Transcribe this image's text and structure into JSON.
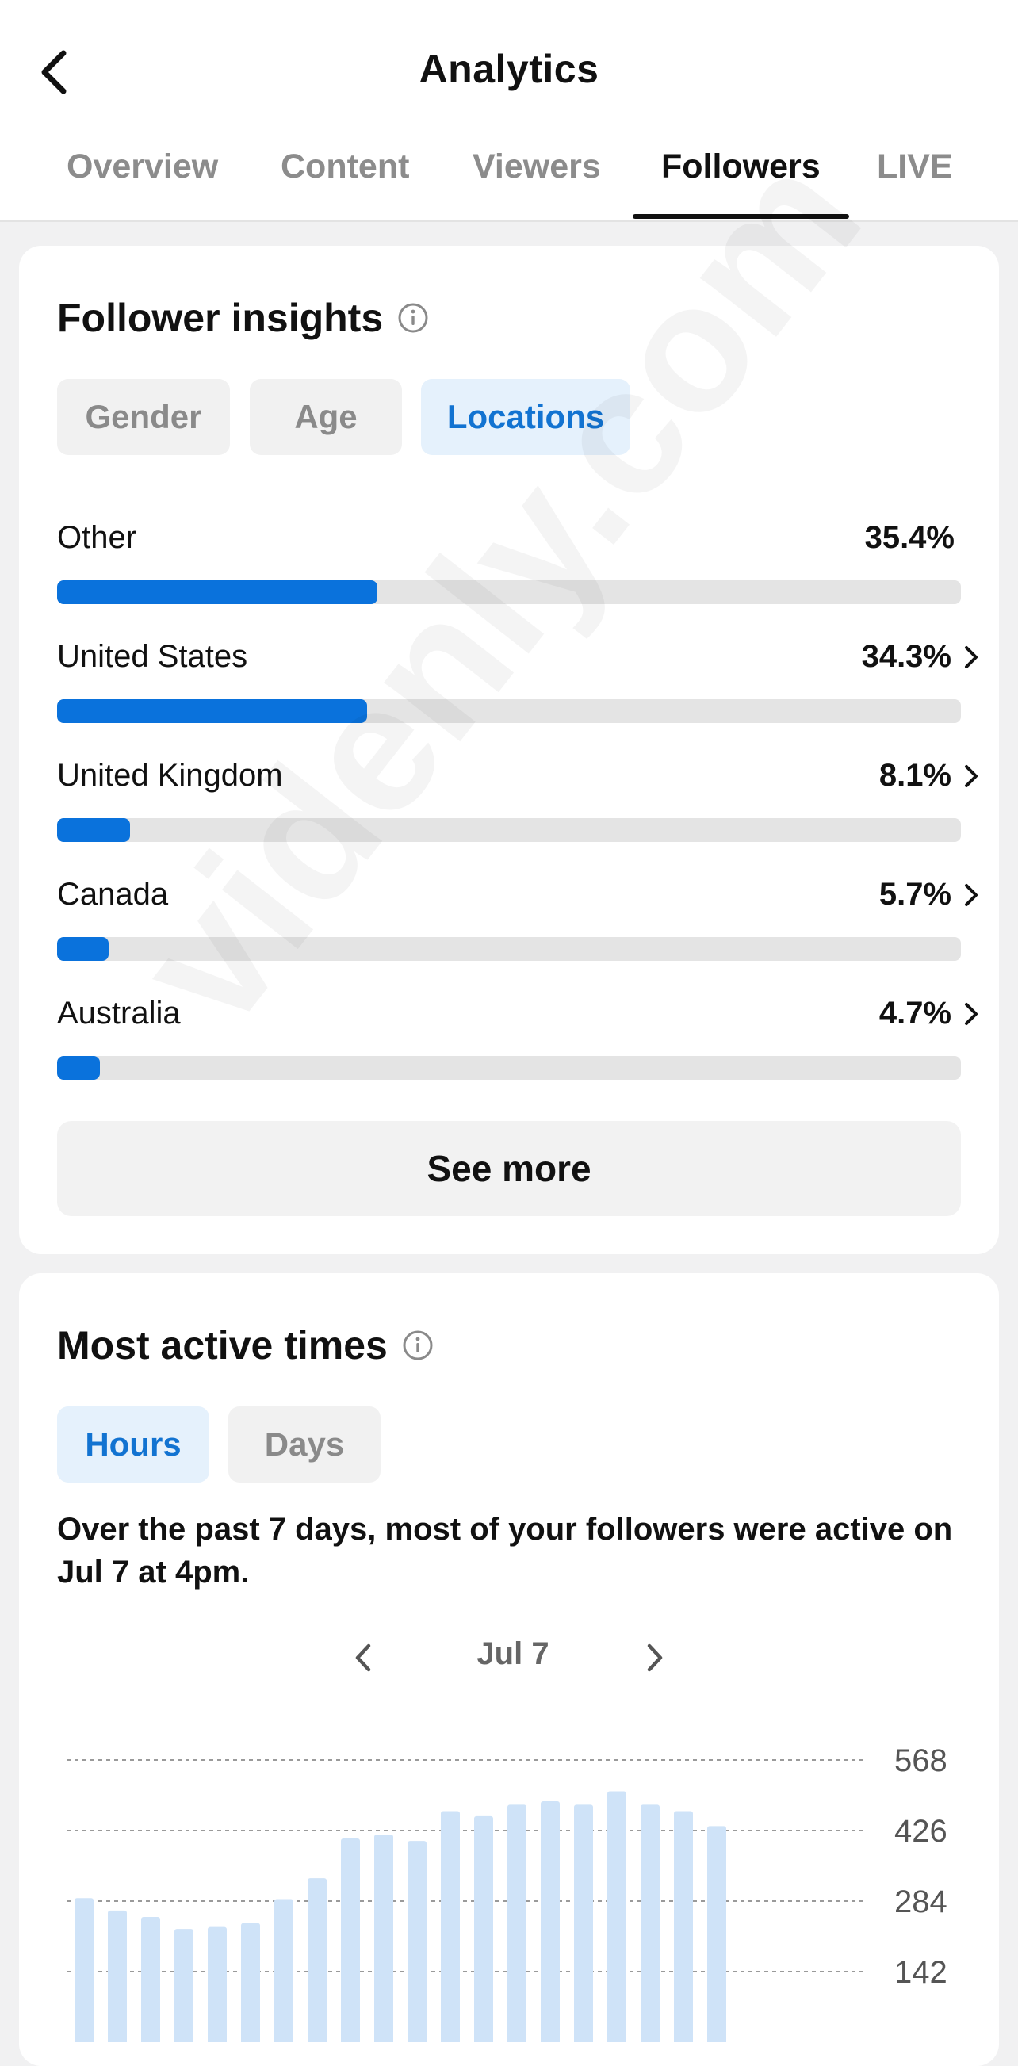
{
  "header": {
    "title": "Analytics",
    "tabs": [
      {
        "label": "Overview",
        "active": false
      },
      {
        "label": "Content",
        "active": false
      },
      {
        "label": "Viewers",
        "active": false
      },
      {
        "label": "Followers",
        "active": true
      },
      {
        "label": "LIVE",
        "active": false
      }
    ]
  },
  "follower_insights": {
    "title": "Follower insights",
    "filters": [
      "Gender",
      "Age",
      "Locations"
    ],
    "active_filter": "Locations",
    "locations": [
      {
        "name": "Other",
        "percent": "35.4%",
        "value": 35.4,
        "has_chevron": false
      },
      {
        "name": "United States",
        "percent": "34.3%",
        "value": 34.3,
        "has_chevron": true
      },
      {
        "name": "United Kingdom",
        "percent": "8.1%",
        "value": 8.1,
        "has_chevron": true
      },
      {
        "name": "Canada",
        "percent": "5.7%",
        "value": 5.7,
        "has_chevron": true
      },
      {
        "name": "Australia",
        "percent": "4.7%",
        "value": 4.7,
        "has_chevron": true
      }
    ],
    "see_more_label": "See more"
  },
  "most_active": {
    "title": "Most active times",
    "filters": [
      "Hours",
      "Days"
    ],
    "active_filter": "Hours",
    "summary": "Over the past 7 days, most of your followers were active on Jul 7 at 4pm.",
    "date_label": "Jul 7"
  },
  "chart_data": {
    "type": "bar",
    "title": "",
    "xlabel": "",
    "ylabel": "",
    "y_ticks": [
      "568",
      "426",
      "284",
      "142"
    ],
    "ylim": [
      0,
      568
    ],
    "grid": true,
    "values": [
      290,
      265,
      252,
      228,
      232,
      240,
      288,
      330,
      410,
      418,
      405,
      465,
      455,
      478,
      485,
      478,
      505,
      478,
      465,
      435
    ],
    "color": "#cfe3f8"
  },
  "colors": {
    "accent": "#0a72dc",
    "chip_active_bg": "#e5f1fc",
    "chip_active_text": "#1273d1"
  },
  "watermark": "videnly.com"
}
